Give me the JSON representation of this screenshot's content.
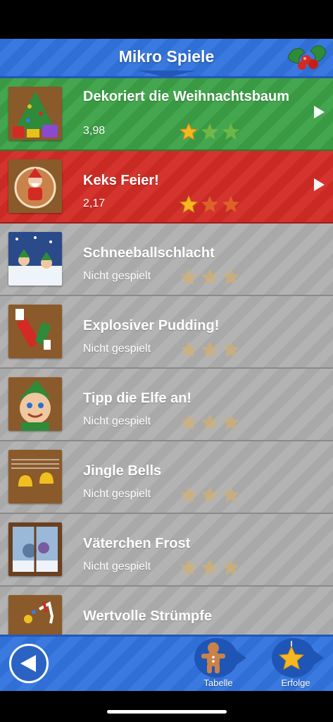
{
  "header": {
    "title": "Mikro Spiele"
  },
  "games": [
    {
      "title": "Dekoriert die Weihnachtsbaum",
      "sub": "3,98",
      "stars_filled": 1,
      "variant": "green",
      "thumb_icon": "christmas-tree-icon"
    },
    {
      "title": "Keks Feier!",
      "sub": "2,17",
      "stars_filled": 1,
      "variant": "red",
      "thumb_icon": "gingerbread-santa-icon"
    },
    {
      "title": "Schneeballschlacht",
      "sub": "Nicht gespielt",
      "stars_filled": 0,
      "variant": "gray",
      "thumb_icon": "snowball-elves-icon"
    },
    {
      "title": "Explosiver Pudding!",
      "sub": "Nicht gespielt",
      "stars_filled": 0,
      "variant": "gray",
      "thumb_icon": "christmas-cracker-icon"
    },
    {
      "title": "Tipp die Elfe an!",
      "sub": "Nicht gespielt",
      "stars_filled": 0,
      "variant": "gray",
      "thumb_icon": "elf-face-icon"
    },
    {
      "title": "Jingle Bells",
      "sub": "Nicht gespielt",
      "stars_filled": 0,
      "variant": "gray",
      "thumb_icon": "bells-icon"
    },
    {
      "title": "Väterchen Frost",
      "sub": "Nicht gespielt",
      "stars_filled": 0,
      "variant": "gray",
      "thumb_icon": "frost-window-icon"
    },
    {
      "title": "Wertvolle Strümpfe",
      "sub": "",
      "stars_filled": 0,
      "variant": "gray",
      "thumb_icon": "stocking-icon"
    }
  ],
  "footer": {
    "back_icon": "back-arrow-icon",
    "leaderboard_label": "Tabelle",
    "leaderboard_icon": "gingerbread-man-icon",
    "achievements_label": "Erfolge",
    "achievements_icon": "star-ornament-icon"
  },
  "colors": {
    "header_blue": "#2f6fd6",
    "row_green": "#3a9a44",
    "row_red": "#c92a24",
    "row_gray": "#a9a9a9",
    "star_gold": "#f5b820"
  }
}
